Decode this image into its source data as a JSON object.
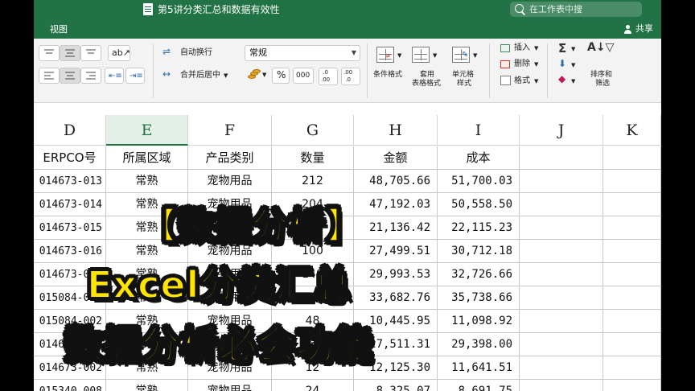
{
  "window": {
    "doc_title": "第5讲分类汇总和数据有效性",
    "search_placeholder": "在工作表中搜"
  },
  "tabs": {
    "active": "视图",
    "share": "共享"
  },
  "ribbon": {
    "wrap_text": "自动换行",
    "merge_center": "合并后居中",
    "number_format": "常规",
    "percent": "%",
    "thousands": "000",
    "inc_decimal": ".0\n.00",
    "dec_decimal": ".00\n.0",
    "conditional_format": "条件格式",
    "table_format_line1": "套用",
    "table_format_line2": "表格格式",
    "cell_style_line1": "单元格",
    "cell_style_line2": "样式",
    "insert": "插入",
    "delete": "删除",
    "format": "格式",
    "sort_filter_line1": "排序和",
    "sort_filter_line2": "筛选"
  },
  "columns": [
    "D",
    "E",
    "F",
    "G",
    "H",
    "I",
    "J",
    "K"
  ],
  "active_column": "E",
  "table": {
    "headers": [
      "ERPCO号",
      "所属区域",
      "产品类别",
      "数量",
      "金额",
      "成本"
    ],
    "rows": [
      [
        "014673-013",
        "常熟",
        "宠物用品",
        "212",
        "48,705.66",
        "51,700.03"
      ],
      [
        "014673-014",
        "常熟",
        "宠物用品",
        "204",
        "47,192.03",
        "50,558.50"
      ],
      [
        "014673-015",
        "常熟",
        "宠物用品",
        "94",
        "21,136.42",
        "22,115.23"
      ],
      [
        "014673-016",
        "常熟",
        "宠物用品",
        "100",
        "27,499.51",
        "30,712.18"
      ],
      [
        "014673-017",
        "常熟",
        "宠物用品",
        "140",
        "29,993.53",
        "32,726.66"
      ],
      [
        "015084-001",
        "常熟",
        "宠物用品",
        "138",
        "33,682.76",
        "35,738.66"
      ],
      [
        "015084-002",
        "常熟",
        "宠物用品",
        "48",
        "10,445.95",
        "11,098.92"
      ],
      [
        "014673-001",
        "常熟",
        "宠物用品",
        "130",
        "27,511.31",
        "29,398.00"
      ],
      [
        "014673-002",
        "常熟",
        "宠物用品",
        "12",
        "12,125.30",
        "11,641.51"
      ],
      [
        "015340-008",
        "常熟",
        "宠物用品",
        "24",
        "8,325.07",
        "8,691.75"
      ]
    ]
  },
  "caption": {
    "line1": "【数据分析】",
    "line2": "Excel分类汇总",
    "line3": "数据分析必会功能"
  },
  "colors": {
    "excel_green": "#217346",
    "caption_fill": "#ffe400",
    "caption_stroke": "#111111"
  },
  "icons": {
    "title": "document-icon",
    "search": "search-icon",
    "share": "person-icon"
  }
}
